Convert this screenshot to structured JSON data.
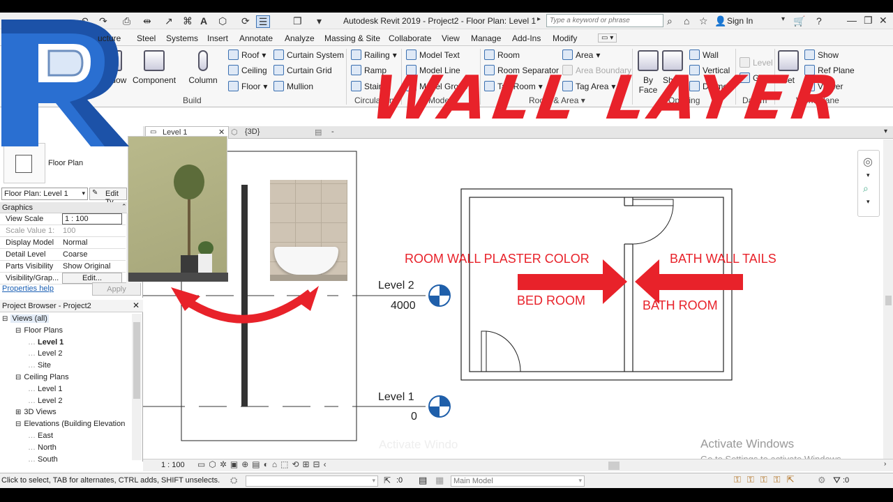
{
  "window": {
    "title": "Autodesk Revit 2019 -  Project2 - Floor Plan: Level 1",
    "search_placeholder": "Type a keyword or phrase",
    "sign_in": "Sign In"
  },
  "ribbon_tabs": [
    "ucture",
    "Steel",
    "Systems",
    "Insert",
    "Annotate",
    "Analyze",
    "Massing & Site",
    "Collaborate",
    "View",
    "Manage",
    "Add-Ins",
    "Modify"
  ],
  "ribbon": {
    "build": {
      "window": "Window",
      "component": "Component",
      "column": "Column",
      "roof": "Roof",
      "ceiling": "Ceiling",
      "floor": "Floor",
      "curtain_system": "Curtain System",
      "curtain_grid": "Curtain Grid",
      "mullion": "Mullion",
      "label": "Build"
    },
    "circulation": {
      "railing": "Railing",
      "ramp": "Ramp",
      "stair": "Stair",
      "label": "Circulation"
    },
    "model": {
      "model_text": "Model Text",
      "model_line": "Model Line",
      "model_group": "Model Group",
      "label": "Model"
    },
    "room_area": {
      "room": "Room",
      "room_separator": "Room Separator",
      "tag_room": "Tag Room",
      "area": "Area",
      "area_boundary": "Area Boundary",
      "tag_area": "Tag Area",
      "label": "Room & Area"
    },
    "opening": {
      "by_face": "By Face",
      "shaft": "Shaft",
      "wall": "Wall",
      "vertical": "Vertical",
      "dormer": "Dormer",
      "label": "Opening"
    },
    "datum": {
      "level": "Level",
      "grid": "Grid",
      "label": "Datum"
    },
    "work_plane": {
      "set": "Set",
      "show": "Show",
      "ref_plane": "Ref Plane",
      "viewer": "Viewer",
      "label": "Work Plane"
    }
  },
  "overlay_title": "WALL LAYER",
  "view_tabs": {
    "level1": "Level 1",
    "view3d": "{3D}",
    "dash": "-"
  },
  "properties": {
    "type_name": "Floor Plan",
    "view_selector": "Floor Plan: Level 1",
    "edit_type": "Edit Ty",
    "section": "Graphics",
    "rows": [
      {
        "k": "View Scale",
        "v": "1 : 100"
      },
      {
        "k": "Scale Value    1:",
        "v": "100"
      },
      {
        "k": "Display Model",
        "v": "Normal"
      },
      {
        "k": "Detail Level",
        "v": "Coarse"
      },
      {
        "k": "Parts Visibility",
        "v": "Show Original"
      },
      {
        "k": "Visibility/Grap...",
        "v": "Edit..."
      }
    ],
    "help": "Properties help",
    "apply": "Apply"
  },
  "browser": {
    "title": "Project Browser - Project2",
    "items": [
      {
        "text": "Views (all)",
        "indent": 0
      },
      {
        "text": "Floor Plans",
        "indent": 1
      },
      {
        "text": "Level 1",
        "indent": 2,
        "bold": true
      },
      {
        "text": "Level 2",
        "indent": 2
      },
      {
        "text": "Site",
        "indent": 2
      },
      {
        "text": "Ceiling Plans",
        "indent": 1
      },
      {
        "text": "Level 1",
        "indent": 2
      },
      {
        "text": "Level 2",
        "indent": 2
      },
      {
        "text": "3D Views",
        "indent": 1
      },
      {
        "text": "Elevations (Building Elevation",
        "indent": 1
      },
      {
        "text": "East",
        "indent": 2
      },
      {
        "text": "North",
        "indent": 2
      },
      {
        "text": "South",
        "indent": 2
      }
    ]
  },
  "canvas": {
    "level2_name": "Level 2",
    "level2_elev": "4000",
    "level1_name": "Level 1",
    "level1_elev": "0",
    "plaster_label": "ROOM WALL PLASTER COLOR",
    "bath_tails_label": "BATH WALL TAILS",
    "bed_room": "BED ROOM",
    "bath_room": "BATH ROOM",
    "watermark_title": "Activate Windows",
    "watermark_sub": "Go to Settings to activate Windows.",
    "ghost_text": "Activate Windo"
  },
  "view_control": {
    "scale": "1 : 100"
  },
  "status": {
    "hint": "Click to select, TAB for alternates, CTRL adds, SHIFT unselects.",
    "selection_count": ":0",
    "model": "Main Model",
    "filter_count": ":0"
  },
  "colors": {
    "accent_red": "#e8222a",
    "revit_blue": "#1f5faa"
  }
}
